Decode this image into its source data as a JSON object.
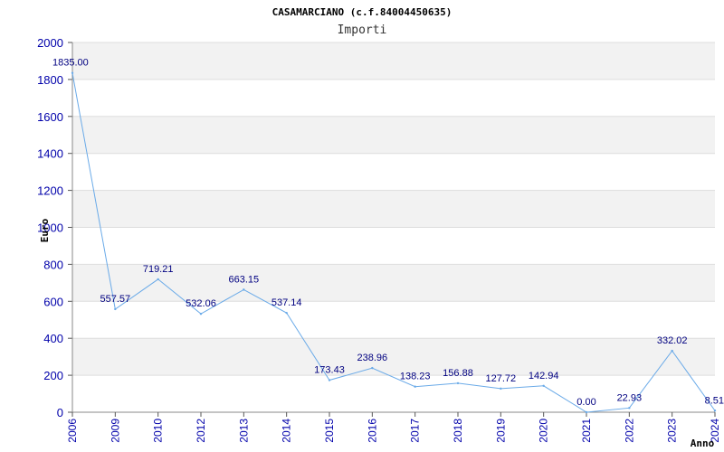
{
  "chart_data": {
    "type": "line",
    "title": "CASAMARCIANO (c.f.84004450635)",
    "subtitle": "Importi",
    "xlabel": "Anno",
    "ylabel": "Euro",
    "ylim": [
      0,
      2000
    ],
    "yticks": [
      0,
      200,
      400,
      600,
      800,
      1000,
      1200,
      1400,
      1600,
      1800,
      2000
    ],
    "grid": true,
    "categories": [
      "2006",
      "2009",
      "2010",
      "2012",
      "2013",
      "2014",
      "2015",
      "2016",
      "2017",
      "2018",
      "2019",
      "2020",
      "2021",
      "2022",
      "2023",
      "2024"
    ],
    "values": [
      1835.0,
      557.57,
      719.21,
      532.06,
      663.15,
      537.14,
      173.43,
      238.96,
      138.23,
      156.88,
      127.72,
      142.94,
      0.0,
      22.93,
      332.02,
      8.51
    ],
    "labels": [
      "1835.00",
      "557.57",
      "719.21",
      "532.06",
      "663.15",
      "537.14",
      "173.43",
      "238.96",
      "138.23",
      "156.88",
      "127.72",
      "142.94",
      "0.00",
      "22.93",
      "332.02",
      "8.51"
    ],
    "colors": {
      "line": "#6aaae8",
      "tick_text": "#0000aa",
      "label_text": "#000080",
      "band": "#f2f2f2",
      "grid": "#dddddd"
    }
  }
}
